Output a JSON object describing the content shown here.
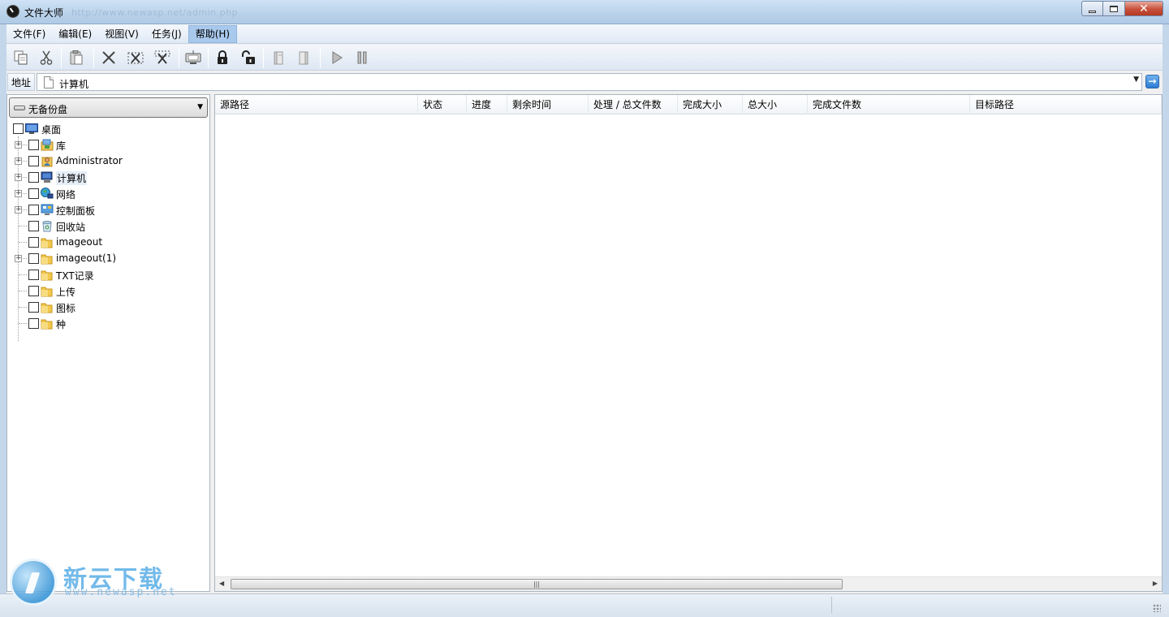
{
  "window": {
    "title": "文件大师",
    "background_url": "http://www.newasp.net/admin.php",
    "close_glyph": "✕"
  },
  "menu": [
    {
      "label": "文件(F)"
    },
    {
      "label": "编辑(E)"
    },
    {
      "label": "视图(V)"
    },
    {
      "label": "任务(J)"
    },
    {
      "label": "帮助(H)",
      "active": true
    }
  ],
  "toolbar": {
    "icons": [
      "copy-icon",
      "cut-icon",
      "paste-icon",
      "delete-icon",
      "select-delete-icon",
      "deselect-delete-icon",
      "monitor-icon",
      "lock-icon",
      "unlock-icon",
      "book-icon",
      "book2-icon",
      "play-icon",
      "pause-icon"
    ]
  },
  "address": {
    "label": "地址",
    "value": "计算机",
    "dropdown": "▼",
    "go": "→"
  },
  "left": {
    "drive_selector": "无备份盘",
    "drive_caret": "▼",
    "tree": [
      {
        "label": "桌面",
        "icon": "desktop-icon",
        "level": 0,
        "expandable": false
      },
      {
        "label": "库",
        "icon": "library-icon",
        "level": 1,
        "expandable": true
      },
      {
        "label": "Administrator",
        "icon": "user-icon",
        "level": 1,
        "expandable": true
      },
      {
        "label": "计算机",
        "icon": "computer-icon",
        "level": 1,
        "expandable": true,
        "selected": true
      },
      {
        "label": "网络",
        "icon": "network-icon",
        "level": 1,
        "expandable": true
      },
      {
        "label": "控制面板",
        "icon": "control-panel-icon",
        "level": 1,
        "expandable": true
      },
      {
        "label": "回收站",
        "icon": "recycle-bin-icon",
        "level": 1,
        "expandable": false
      },
      {
        "label": "imageout",
        "icon": "folder-icon",
        "level": 1,
        "expandable": false
      },
      {
        "label": "imageout(1)",
        "icon": "folder-icon",
        "level": 1,
        "expandable": true
      },
      {
        "label": "TXT记录",
        "icon": "folder-icon",
        "level": 1,
        "expandable": false
      },
      {
        "label": "上传",
        "icon": "folder-icon",
        "level": 1,
        "expandable": false
      },
      {
        "label": "图标",
        "icon": "folder-icon",
        "level": 1,
        "expandable": false
      },
      {
        "label": "种",
        "icon": "folder-icon",
        "level": 1,
        "expandable": false
      }
    ]
  },
  "list": {
    "columns": [
      {
        "label": "源路径"
      },
      {
        "label": "状态"
      },
      {
        "label": "进度"
      },
      {
        "label": "剩余时间"
      },
      {
        "label": "处理 / 总文件数"
      },
      {
        "label": "完成大小"
      },
      {
        "label": "总大小"
      },
      {
        "label": "完成文件数"
      },
      {
        "label": "目标路径"
      }
    ],
    "scroll_left": "◀",
    "scroll_right": "▶",
    "scroll_grip": "|||"
  },
  "watermark": {
    "text": "新云下载",
    "url": "www.newasp.net"
  }
}
